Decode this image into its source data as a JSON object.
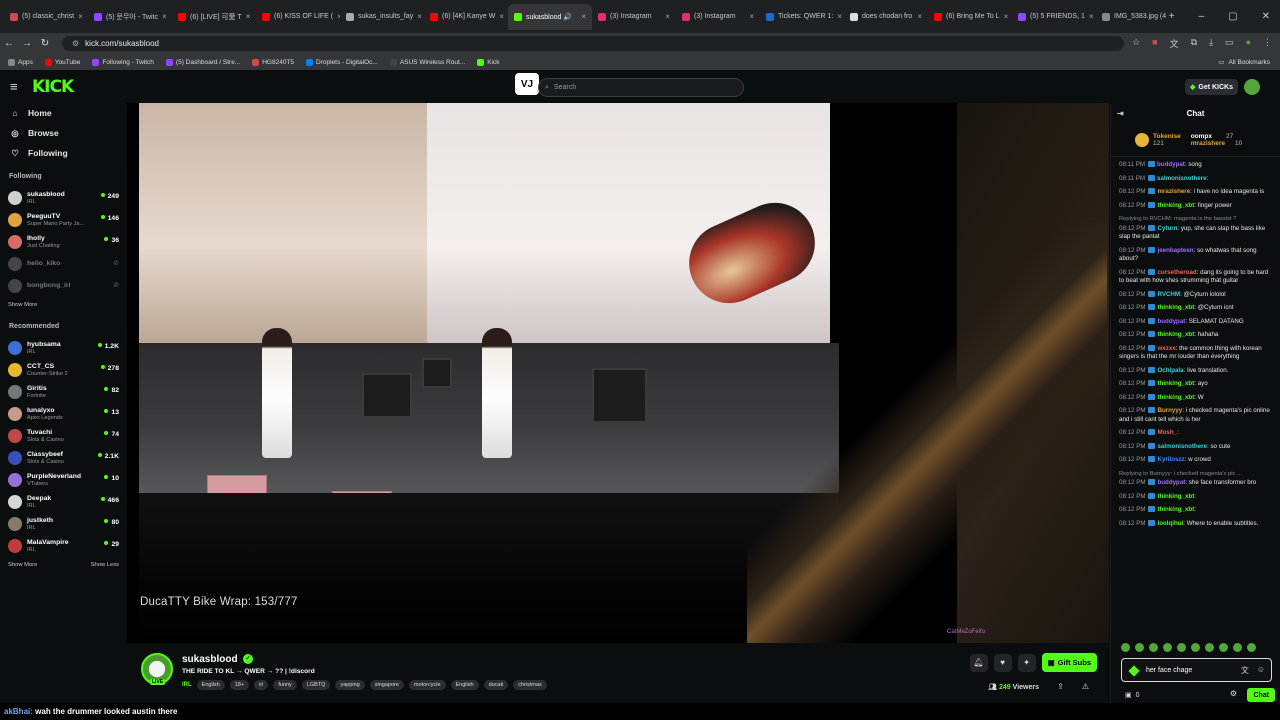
{
  "browser": {
    "tabs": [
      {
        "label": "(5) classic_christ",
        "fav": "#d24b4b"
      },
      {
        "label": "(5) 문무아 - Twitc",
        "fav": "#9147ff"
      },
      {
        "label": "(6) [LIVE] 可愛 T",
        "fav": "#ff0000"
      },
      {
        "label": "(6) KISS OF LIFE (",
        "fav": "#ff0000"
      },
      {
        "label": "sukas_insults_fay",
        "fav": "#aaaaaa"
      },
      {
        "label": "(6) [4K] Kanye W",
        "fav": "#ff0000"
      },
      {
        "label": "sukasblood 🔊",
        "fav": "#53fc18",
        "active": true
      },
      {
        "label": "(3) Instagram",
        "fav": "#e1306c"
      },
      {
        "label": "(3) Instagram",
        "fav": "#e1306c"
      },
      {
        "label": "Tickets: QWER 1:",
        "fav": "#1d6bd1"
      },
      {
        "label": "does chodan fro",
        "fav": "#dddddd"
      },
      {
        "label": "(6) Bring Me To L",
        "fav": "#ff0000"
      },
      {
        "label": "(5) 5 FRIENDS, 1",
        "fav": "#9147ff"
      },
      {
        "label": "IMG_5383.jpg (4",
        "fav": "#888888"
      }
    ],
    "url": "kick.com/sukasblood",
    "bookmarks": [
      {
        "label": "Apps",
        "color": "#888888"
      },
      {
        "label": "YouTube",
        "color": "#ff0000"
      },
      {
        "label": "Following - Twitch",
        "color": "#9147ff"
      },
      {
        "label": "(5) Dashboard / Stre...",
        "color": "#9147ff"
      },
      {
        "label": "HG8240T5",
        "color": "#d24b4b"
      },
      {
        "label": "Droplets - DigitalOc...",
        "color": "#0080ff"
      },
      {
        "label": "ASUS Wireless Rout...",
        "color": "#444444"
      },
      {
        "label": "Kick",
        "color": "#53fc18"
      }
    ],
    "all_bookmarks": "All Bookmarks"
  },
  "kick": {
    "logo": "KICK",
    "vj": "VJ",
    "search_placeholder": "Search",
    "get_kicks": "Get KICKs"
  },
  "sidebar": {
    "nav": [
      {
        "label": "Home",
        "icon": "home-icon"
      },
      {
        "label": "Browse",
        "icon": "compass-icon"
      },
      {
        "label": "Following",
        "icon": "heart-icon"
      }
    ],
    "following_title": "Following",
    "following": [
      {
        "name": "sukasblood",
        "game": "IRL",
        "viewers": "249",
        "color": "#cfcfcf"
      },
      {
        "name": "PeeguuTV",
        "game": "Super Mario Party Ja...",
        "viewers": "146",
        "color": "#e0a23c"
      },
      {
        "name": "Iholly",
        "game": "Just Chatting",
        "viewers": "36",
        "color": "#d66b6b"
      },
      {
        "name": "hello_kiko",
        "game": "",
        "viewers": "",
        "color": "#999999",
        "offline": true
      },
      {
        "name": "bongbong_irl",
        "game": "",
        "viewers": "",
        "color": "#999999",
        "offline": true
      }
    ],
    "show_more": "Show More",
    "recommended_title": "Recommended",
    "recommended": [
      {
        "name": "hyubsama",
        "game": "IRL",
        "viewers": "1.2K",
        "color": "#3d6fd6"
      },
      {
        "name": "CCT_CS",
        "game": "Counter-Strike 2",
        "viewers": "278",
        "color": "#e8b52c"
      },
      {
        "name": "Giritis",
        "game": "Fortnite",
        "viewers": "82",
        "color": "#777777"
      },
      {
        "name": "lunalyxo",
        "game": "Apex Legends",
        "viewers": "13",
        "color": "#c79a8c"
      },
      {
        "name": "Tuvachi",
        "game": "Slots & Casino",
        "viewers": "74",
        "color": "#c04a4a"
      },
      {
        "name": "Classybeef",
        "game": "Slots & Casino",
        "viewers": "2.1K",
        "color": "#3a4fb8"
      },
      {
        "name": "PurpleNeverland",
        "game": "VTubers",
        "viewers": "10",
        "color": "#9b6bd6"
      },
      {
        "name": "Deepak",
        "game": "IRL",
        "viewers": "466",
        "color": "#d6d6d6"
      },
      {
        "name": "justketh",
        "game": "IRL",
        "viewers": "80",
        "color": "#8a7a6a"
      },
      {
        "name": "MalaVampire",
        "game": "IRL",
        "viewers": "29",
        "color": "#c23b3b"
      }
    ],
    "show_more_2": "Show More",
    "show_less": "Show Less"
  },
  "player": {
    "overlay": "DucaTTY Bike Wrap: 153/777",
    "corner_tag": "CatMeZoFeifo"
  },
  "stream": {
    "channel": "sukasblood",
    "title": "THE RIDE TO KL → QWER → ?? | !discord",
    "category": "IRL",
    "tags": [
      "English",
      "18+",
      "irl",
      "funny",
      "LGBTQ",
      "yapping",
      "singapore",
      "motorcycle",
      "English",
      "ducati",
      "christmas"
    ],
    "live": "LIVE",
    "gift_subs": "Gift Subs",
    "viewers_count": "249",
    "viewers_label": "Viewers"
  },
  "chat": {
    "title": "Chat",
    "pinned": [
      {
        "name": "Tokenise",
        "num": "121"
      },
      {
        "name": "oompx",
        "num": "27"
      },
      {
        "name": "mrazishere",
        "num": "10"
      }
    ],
    "messages": [
      {
        "time": "08:11 PM",
        "user": "buddypat",
        "color": "#a06cff",
        "text": "song"
      },
      {
        "time": "08:11 PM",
        "user": "salmonisnothere",
        "color": "#3fd0d0",
        "text": ""
      },
      {
        "time": "08:12 PM",
        "user": "mrazishere",
        "color": "#e6a23b",
        "text": "i have no idea magenta is"
      },
      {
        "time": "08:12 PM",
        "user": "thinking_xbt",
        "color": "#53fc18",
        "text": "finger power"
      },
      {
        "reply": "Replying to RVCHM: magenta is the bassist ?"
      },
      {
        "time": "08:12 PM",
        "user": "Cyturn",
        "color": "#3fd0d0",
        "text": "yup, she can slap the bass like slap the pantat"
      },
      {
        "time": "08:12 PM",
        "user": "jeenbapteen",
        "color": "#a06cff",
        "text": "so whatwas that song about?"
      },
      {
        "time": "08:12 PM",
        "user": "cursetheroad",
        "color": "#ff5c5c",
        "text": "dang its going to be hard to beat with how shes strumming that guitar"
      },
      {
        "time": "08:12 PM",
        "user": "RVCHM",
        "color": "#3fd0d0",
        "text": "@Cyturn lololol"
      },
      {
        "time": "08:12 PM",
        "user": "thinking_xbt",
        "color": "#53fc18",
        "text": "@Cyturn icnt"
      },
      {
        "time": "08:12 PM",
        "user": "buddypat",
        "color": "#a06cff",
        "text": "SELAMAT DATANG"
      },
      {
        "time": "08:12 PM",
        "user": "thinking_xbt",
        "color": "#53fc18",
        "text": "hahaha"
      },
      {
        "time": "08:12 PM",
        "user": "wxzxx",
        "color": "#ff5c5c",
        "text": "the common thing with korean singers is that the mr louder than everything"
      },
      {
        "time": "08:12 PM",
        "user": "Ochipala",
        "color": "#3fd0d0",
        "text": "live translation."
      },
      {
        "time": "08:12 PM",
        "user": "thinking_xbt",
        "color": "#53fc18",
        "text": "ayo"
      },
      {
        "time": "08:12 PM",
        "user": "thinking_xbt",
        "color": "#53fc18",
        "text": "W"
      },
      {
        "time": "08:12 PM",
        "user": "Burnyyy",
        "color": "#e6a23b",
        "text": "i checked magenta's pic online and i still cant tell which is her"
      },
      {
        "time": "08:12 PM",
        "user": "Mosh_",
        "color": "#ff5c5c",
        "text": ""
      },
      {
        "time": "08:12 PM",
        "user": "salmonisnothere",
        "color": "#3fd0d0",
        "text": "so cute"
      },
      {
        "time": "08:12 PM",
        "user": "Kyriloszz",
        "color": "#3d8bff",
        "text": "w crowd"
      },
      {
        "reply": "Replying to Burnyyy: i checked magenta's pic ..."
      },
      {
        "time": "08:12 PM",
        "user": "buddypat",
        "color": "#a06cff",
        "text": "she face transformer bro"
      },
      {
        "time": "08:12 PM",
        "user": "thinking_xbt",
        "color": "#53fc18",
        "text": ""
      },
      {
        "time": "08:12 PM",
        "user": "thinking_xbt",
        "color": "#53fc18",
        "text": ""
      },
      {
        "time": "08:12 PM",
        "user": "loolqihui",
        "color": "#53fc18",
        "text": "Where to enable subtitles."
      }
    ],
    "input_value": "her face chage",
    "points": "0",
    "chat_button": "Chat"
  },
  "bottom_caption": {
    "user": "akBhai:",
    "text": "wah the drummer looked austin there"
  }
}
